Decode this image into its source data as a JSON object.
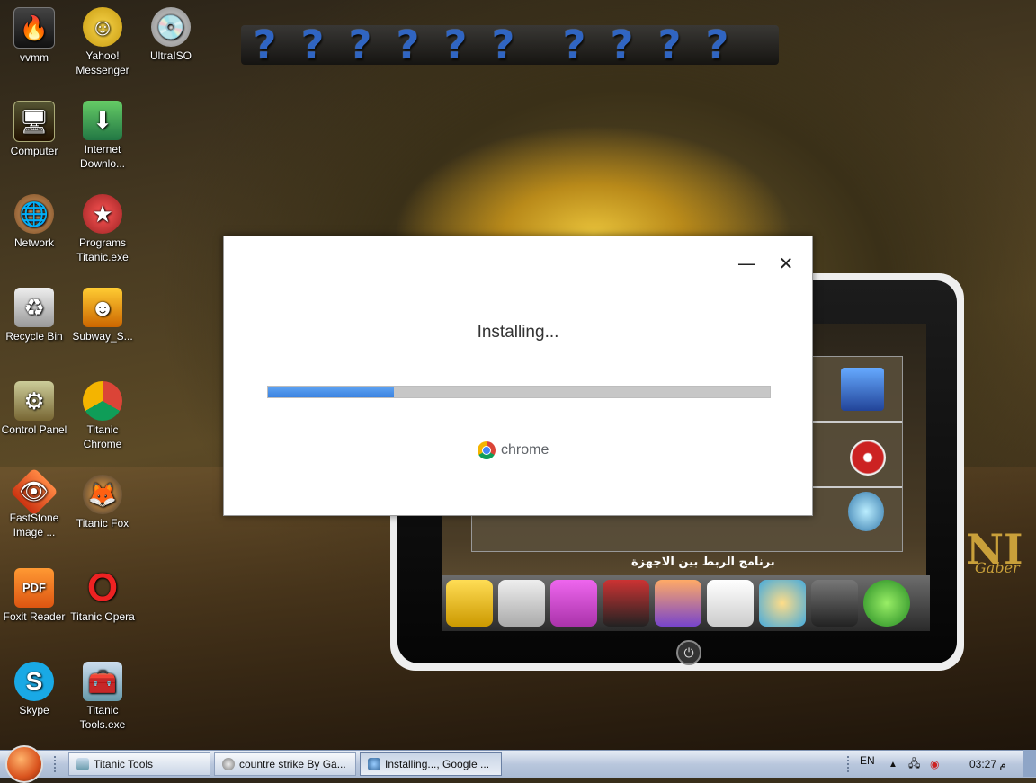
{
  "desktop_icons": [
    {
      "label": "vvmm",
      "icon": "folder-icon"
    },
    {
      "label": "Yahoo! Messenger",
      "icon": "yahoo-messenger-icon"
    },
    {
      "label": "UltraISO",
      "icon": "ultraiso-icon"
    },
    {
      "label": "Computer",
      "icon": "computer-icon"
    },
    {
      "label": "Internet Downlo...",
      "icon": "internet-download-manager-icon"
    },
    {
      "label": "Network",
      "icon": "network-icon"
    },
    {
      "label": "Programs Titanic.exe",
      "icon": "programs-titanic-icon"
    },
    {
      "label": "Recycle Bin",
      "icon": "recycle-bin-icon"
    },
    {
      "label": "Subway_S...",
      "icon": "subway-surfers-icon"
    },
    {
      "label": "Control Panel",
      "icon": "control-panel-icon"
    },
    {
      "label": "Titanic Chrome",
      "icon": "chrome-icon"
    },
    {
      "label": "FastStone Image ...",
      "icon": "faststone-icon"
    },
    {
      "label": "Titanic Fox",
      "icon": "firefox-icon"
    },
    {
      "label": "Foxit Reader",
      "icon": "pdf-icon"
    },
    {
      "label": "Titanic Opera",
      "icon": "opera-icon"
    },
    {
      "label": "Skype",
      "icon": "skype-icon"
    },
    {
      "label": "Titanic Tools.exe",
      "icon": "tools-icon"
    }
  ],
  "question_dock": {
    "items": [
      "?",
      "?",
      "?",
      "?",
      "?",
      "?",
      "?",
      "?",
      "?",
      "?"
    ]
  },
  "tablet": {
    "arabic_caption": "برنامج الربط بين الاجهزة",
    "side_text": "NI",
    "side_text_2": "Gaber"
  },
  "installer": {
    "status": "Installing...",
    "progress": 0.25,
    "brand": "chrome",
    "minimize_glyph": "—",
    "close_glyph": "✕"
  },
  "taskbar": {
    "tasks": [
      {
        "label": "Titanic Tools",
        "icon": "tools-icon",
        "active": false
      },
      {
        "label": "countre strike By Ga...",
        "icon": "cs-icon",
        "active": false
      },
      {
        "label": "Installing..., Google ...",
        "icon": "installer-icon",
        "active": true
      }
    ],
    "language": "EN",
    "clock": "03:27 م"
  },
  "colors": {
    "progress_fill": "#3b82e0",
    "progress_track": "#c7c7c7",
    "question_mark": "#2f6fe0"
  }
}
